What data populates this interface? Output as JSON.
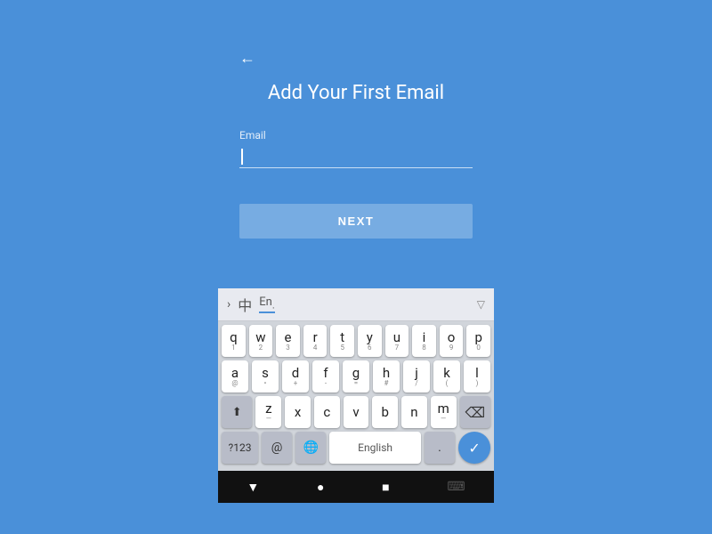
{
  "page": {
    "background_color": "#4A90D9"
  },
  "header": {
    "back_label": "←",
    "title": "Add Your First Email"
  },
  "form": {
    "email_label": "Email",
    "email_placeholder": "",
    "next_button": "NEXT"
  },
  "keyboard": {
    "toolbar": {
      "arrow": "›",
      "chinese_char": "中",
      "lang": "En",
      "lang_sub": ".",
      "collapse": "▽"
    },
    "rows": [
      [
        "q1",
        "w2",
        "e3",
        "r4",
        "t5",
        "y6",
        "u7",
        "i8",
        "o9",
        "p0"
      ],
      [
        "a@",
        "s*",
        "d+",
        "f-",
        "g=",
        "h#",
        "j/",
        "k(",
        "l)"
      ],
      [
        "z",
        "x",
        "c",
        "v",
        "b",
        "n",
        "m"
      ],
      [
        "?123",
        "@",
        "globe",
        "space",
        ".",
        "enter"
      ]
    ],
    "row1": [
      {
        "main": "q",
        "sub": "1"
      },
      {
        "main": "w",
        "sub": "2"
      },
      {
        "main": "e",
        "sub": "3"
      },
      {
        "main": "r",
        "sub": "4"
      },
      {
        "main": "t",
        "sub": "5"
      },
      {
        "main": "y",
        "sub": "6"
      },
      {
        "main": "u",
        "sub": "7"
      },
      {
        "main": "i",
        "sub": "8"
      },
      {
        "main": "o",
        "sub": "9"
      },
      {
        "main": "p",
        "sub": "0"
      }
    ],
    "row2": [
      {
        "main": "a",
        "sub": "@"
      },
      {
        "main": "s",
        "sub": "•"
      },
      {
        "main": "d",
        "sub": "+"
      },
      {
        "main": "f",
        "sub": "-"
      },
      {
        "main": "g",
        "sub": "="
      },
      {
        "main": "h",
        "sub": "#"
      },
      {
        "main": "j",
        "sub": "/"
      },
      {
        "main": "k",
        "sub": "("
      },
      {
        "main": "l",
        "sub": ")"
      }
    ],
    "row3": [
      {
        "main": "z",
        "sub": ""
      },
      {
        "main": "x",
        "sub": ""
      },
      {
        "main": "c",
        "sub": ""
      },
      {
        "main": "v",
        "sub": ""
      },
      {
        "main": "b",
        "sub": ""
      },
      {
        "main": "n",
        "sub": ""
      },
      {
        "main": "m",
        "sub": ""
      }
    ],
    "row4_labels": {
      "num": "?123",
      "at": "@",
      "globe": "🌐",
      "space": "English",
      "dot": ".",
      "enter_check": "✓"
    }
  },
  "system_nav": {
    "back": "▼",
    "home": "●",
    "recent": "■",
    "keyboard": "⌨"
  }
}
